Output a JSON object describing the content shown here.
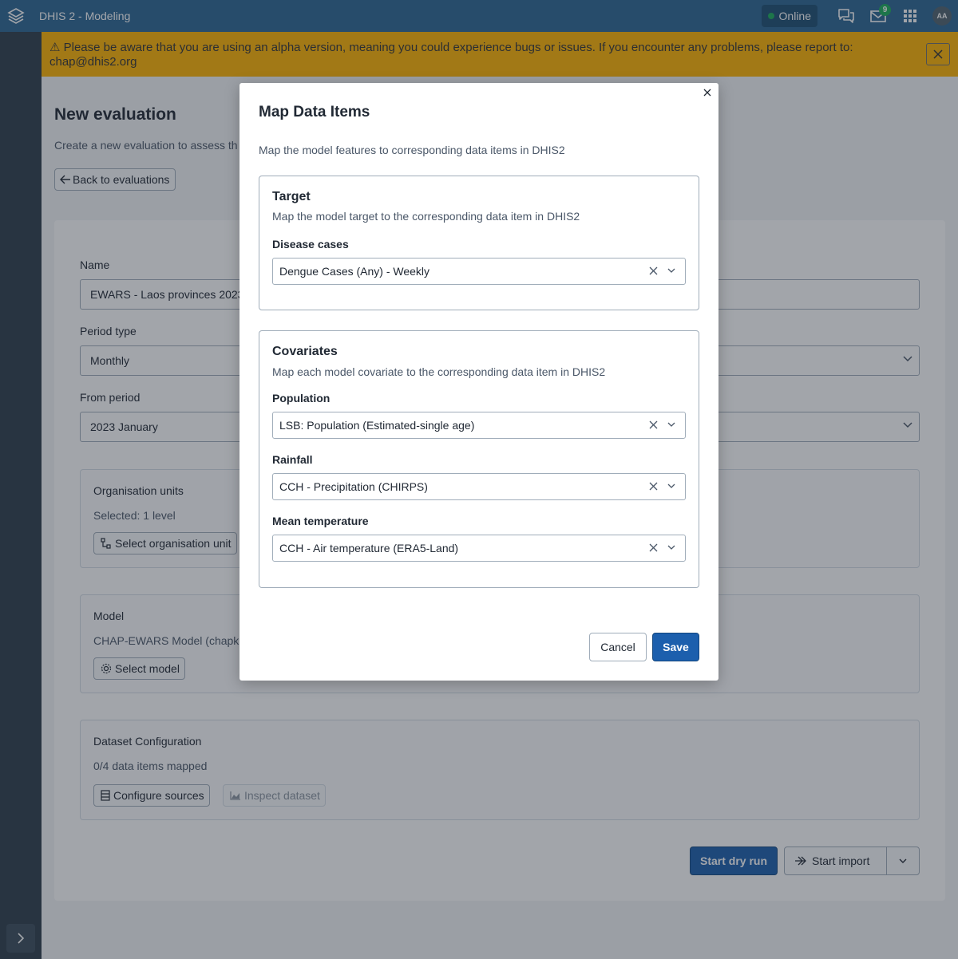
{
  "header": {
    "app_title": "DHIS 2 - Modeling",
    "status": "Online",
    "messages_count": "9",
    "avatar_initials": "AA",
    "icons": [
      "dhis2-logo-icon",
      "interpretations-icon",
      "messages-icon",
      "apps-grid-icon"
    ]
  },
  "banner": {
    "text": "Please be aware that you are using an alpha version, meaning you could experience bugs or issues. If you encounter any problems, please report to:",
    "email": "chap@dhis2.org"
  },
  "page": {
    "title": "New evaluation",
    "subtitle": "Create a new evaluation to assess th",
    "back_label": "Back to evaluations"
  },
  "form": {
    "name_label": "Name",
    "name_value": "EWARS - Laos provinces 2023-",
    "period_type_label": "Period type",
    "period_type_value": "Monthly",
    "from_period_label": "From period",
    "from_period_value": "2023 January",
    "org_units": {
      "title": "Organisation units",
      "selected": "Selected: 1 level",
      "button": "Select organisation unit"
    },
    "model": {
      "title": "Model",
      "value": "CHAP-EWARS Model (chapkit",
      "button": "Select model"
    },
    "dataset": {
      "title": "Dataset Configuration",
      "mapped": "0/4 data items mapped",
      "configure_button": "Configure sources",
      "inspect_button": "Inspect dataset"
    },
    "dry_run_button": "Start dry run",
    "import_button": "Start import"
  },
  "modal": {
    "title": "Map Data Items",
    "description": "Map the model features to corresponding data items in DHIS2",
    "target": {
      "title": "Target",
      "subtitle": "Map the model target to the corresponding data item in DHIS2",
      "fields": [
        {
          "label": "Disease cases",
          "value": "Dengue Cases (Any) - Weekly"
        }
      ]
    },
    "covariates": {
      "title": "Covariates",
      "subtitle": "Map each model covariate to the corresponding data item in DHIS2",
      "fields": [
        {
          "label": "Population",
          "value": "LSB: Population (Estimated-single age)"
        },
        {
          "label": "Rainfall",
          "value": "CCH - Precipitation (CHIRPS)"
        },
        {
          "label": "Mean temperature",
          "value": "CCH - Air temperature (ERA5-Land)"
        }
      ]
    },
    "cancel_label": "Cancel",
    "save_label": "Save"
  },
  "colors": {
    "header": "#2c6693",
    "banner": "#ffb300",
    "primary": "#1c5fad",
    "online": "#1aad5b"
  }
}
